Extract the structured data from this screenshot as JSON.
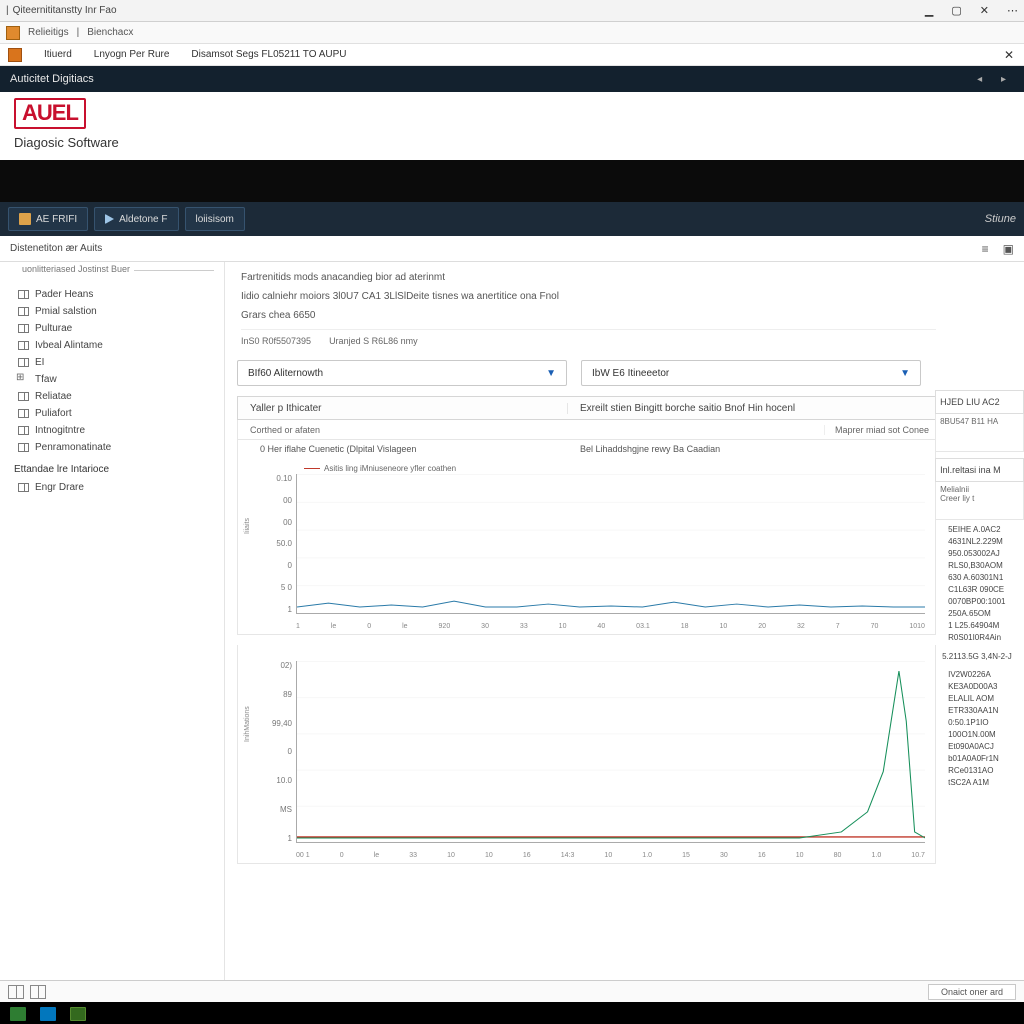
{
  "window": {
    "title": "Qiteernititanstty Inr Fao",
    "min_icon": "▁",
    "max_icon": "▢",
    "close_icon": "✕",
    "overflow_icon": "⋯"
  },
  "subbar": {
    "item1": "Relieitigs",
    "divider": "|",
    "item2": "Bienchacx"
  },
  "menustrip": {
    "item1": "Itiuerd",
    "item2": "Lnyogn Per Rure",
    "item3": "Disamsot Segs FL05211 TO AUPU"
  },
  "dark_hdr": {
    "title": "Auticitet Digitiacs"
  },
  "brand": {
    "logo": "AUEL",
    "subtitle": "Diagosic Software"
  },
  "toolbar": {
    "btn1": "AE FRIFI",
    "btn2": "Aldetone F",
    "btn3": "loiisisom",
    "right": "Stiune"
  },
  "tabstrip": {
    "label": "Distenetiton ær Auits"
  },
  "sidebar": {
    "fieldset": "uonlitteriased Jostinst Buer",
    "items": [
      "Pader Heans",
      "Pmial salstion",
      "Pulturae",
      "Ivbeal Alintame",
      "EI",
      "Tfaw",
      "Reliatae",
      "Puliafort",
      "Intnogitntre",
      "Penramonatinate"
    ],
    "heading2": "Ettandae lre Intarioce",
    "items2": [
      "Engr Drare"
    ]
  },
  "intro": {
    "line1": "Fartrenitids mods anacandieg bior ad aterinmt",
    "line2": "Iidio calniehr moiors 3l0U7 CA1 3LlSlDeite tisnes wa anertitice ona Fnol",
    "line3": "Grars chea 6650",
    "meta1": "InS0 R0f5507395",
    "meta2": "Uranjed S R6L86 nmy"
  },
  "dropdowns": {
    "dd1": "BIf60 Aliternowth",
    "dd2": "IbW E6 Itineeetor"
  },
  "panel": {
    "header_left": "Yaller p Ithicater",
    "header_right": "Exreilt stien Bingitt borche saitio Bnof Hin hocenl",
    "sub_left": "Corthed or afaten",
    "sub_right": "Maprer miad sot Conee",
    "row3_left": "0 Her iflahe Cuenetic (Dlpital Vislageen",
    "row3_right": "Bel Lihaddshgjne rewy Ba Caadian"
  },
  "chart_data": [
    {
      "type": "line",
      "title": "Asitis ling iMniuseneore yfler coathen",
      "ylabel": "Iiiaits",
      "ylim": [
        0,
        0.1
      ],
      "yticks": [
        "0.10",
        "00",
        "00",
        "50.0",
        "0",
        "5 0",
        "1"
      ],
      "xticks": [
        "1",
        "le",
        "0",
        "le",
        "920",
        "30",
        "33",
        "10",
        "40",
        "03.1",
        "18",
        "10",
        "20",
        "32",
        "7",
        "70",
        "1010"
      ],
      "series": [
        {
          "name": "Asitis ling iMniuseneore yfler coathen",
          "color": "#2a7aa8",
          "values": [
            1,
            1.5,
            1,
            1.2,
            1,
            1.8,
            1,
            1,
            1.3,
            1,
            1.1,
            1,
            1.6,
            1,
            1.4,
            1,
            1.2,
            1,
            1.1,
            1,
            1
          ]
        }
      ]
    },
    {
      "type": "line",
      "ylabel": "InihMations",
      "ylim": [
        0,
        100
      ],
      "yticks": [
        "02)",
        "89",
        "99,40",
        "0",
        "10.0",
        "MS",
        "1"
      ],
      "xticks": [
        "00 1",
        "0",
        "le",
        "33",
        "10",
        "10",
        "16",
        "14:3",
        "10",
        "1.0",
        "15",
        "30",
        "16",
        "10",
        "80",
        "1.0",
        "10.7"
      ],
      "series": [
        {
          "name": "baseline",
          "color": "#c0392b",
          "values": [
            1,
            1,
            1,
            1,
            1,
            1,
            1,
            1,
            1,
            1,
            1,
            1,
            1,
            1,
            1,
            1,
            1,
            1,
            1,
            1,
            1
          ]
        },
        {
          "name": "spike",
          "color": "#168f5a",
          "values": [
            1,
            1,
            1,
            1,
            1,
            1,
            1,
            1,
            1,
            1,
            1,
            1,
            1,
            1,
            1,
            1,
            1,
            4,
            30,
            95,
            12
          ]
        }
      ]
    }
  ],
  "rightcol": {
    "header": "HJED LIU AC2",
    "sub1": "8BU547 B11 HA",
    "panel2_hd": "Inl.reltasi ina M",
    "panel2_sub1": "Melialnii",
    "panel2_sub2": "Creer liy t",
    "codes1": [
      "5EIHE A.0AC2",
      "4631NL2.229M",
      "950.053002AJ",
      "RLS0,B30AOM",
      "630 A.60301N1",
      "C1L63R 090CE",
      "0070BP00:1001",
      "250A.65OM",
      "1 L25.64904M",
      "R0S01I0R4Ain"
    ],
    "sep": "5.2113.5G 3,4N-2-J",
    "codes2": [
      "IV2W0226A",
      "KE3A0D00A3",
      "ELALIL AOM",
      "ETR330AA1N",
      "0:50.1P1IO",
      "100O1N.00M",
      "Et090A0ACJ",
      "b01A0A0Fr1N",
      "RCe0131AO",
      "tSC2A A1M"
    ]
  },
  "statusbar": {
    "right_btn": "Onaict oner ard"
  }
}
